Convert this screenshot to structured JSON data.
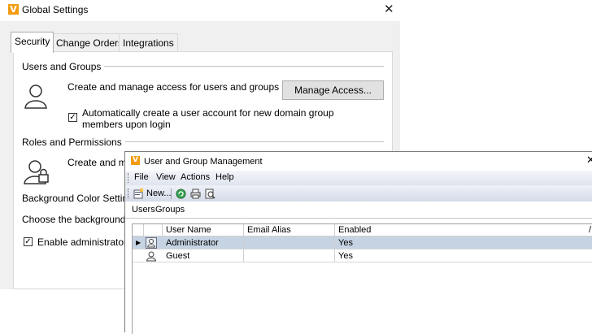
{
  "global_settings": {
    "title": "Global Settings",
    "logo": "V",
    "tabs": [
      {
        "label": "Security",
        "active": true
      },
      {
        "label": "Change Orders",
        "active": false
      },
      {
        "label": "Integrations",
        "active": false
      }
    ],
    "users_and_groups": {
      "heading": "Users and Groups",
      "description": "Create and manage access for users and groups",
      "manage_access_label": "Manage Access...",
      "auto_create_line1": "Automatically create a user account for new domain group",
      "auto_create_line2": "members upon login",
      "auto_create_checked": true
    },
    "roles_and_permissions": {
      "heading": "Roles and Permissions",
      "description_partial": "Create and ma"
    },
    "background_color": {
      "heading_partial": "Background Color Setting",
      "description_partial": "Choose the background c"
    },
    "enable_admin": {
      "label_partial": "Enable administrator s",
      "checked": true
    },
    "icons": {
      "close": "close-icon",
      "user": "user-icon",
      "user-lock": "user-lock-icon"
    }
  },
  "user_group_mgmt": {
    "title": "User and Group Management",
    "logo": "V",
    "menu": [
      "File",
      "View",
      "Actions",
      "Help"
    ],
    "toolbar": {
      "new_label": "New...",
      "icons": [
        "new-icon",
        "refresh-icon",
        "print-icon",
        "print-preview-icon"
      ]
    },
    "tabs": [
      "Users",
      "Groups"
    ],
    "columns": [
      "User Name",
      "Email Alias",
      "Enabled"
    ],
    "column_extra": "/",
    "rows": [
      {
        "name": "Administrator",
        "email": "",
        "enabled": "Yes",
        "selected": true
      },
      {
        "name": "Guest",
        "email": "",
        "enabled": "Yes",
        "selected": false
      }
    ]
  },
  "colors": {
    "accent": "#f39c12",
    "selected_row": "#c5d3e3",
    "dialog_bg": "#f0f0f0"
  }
}
